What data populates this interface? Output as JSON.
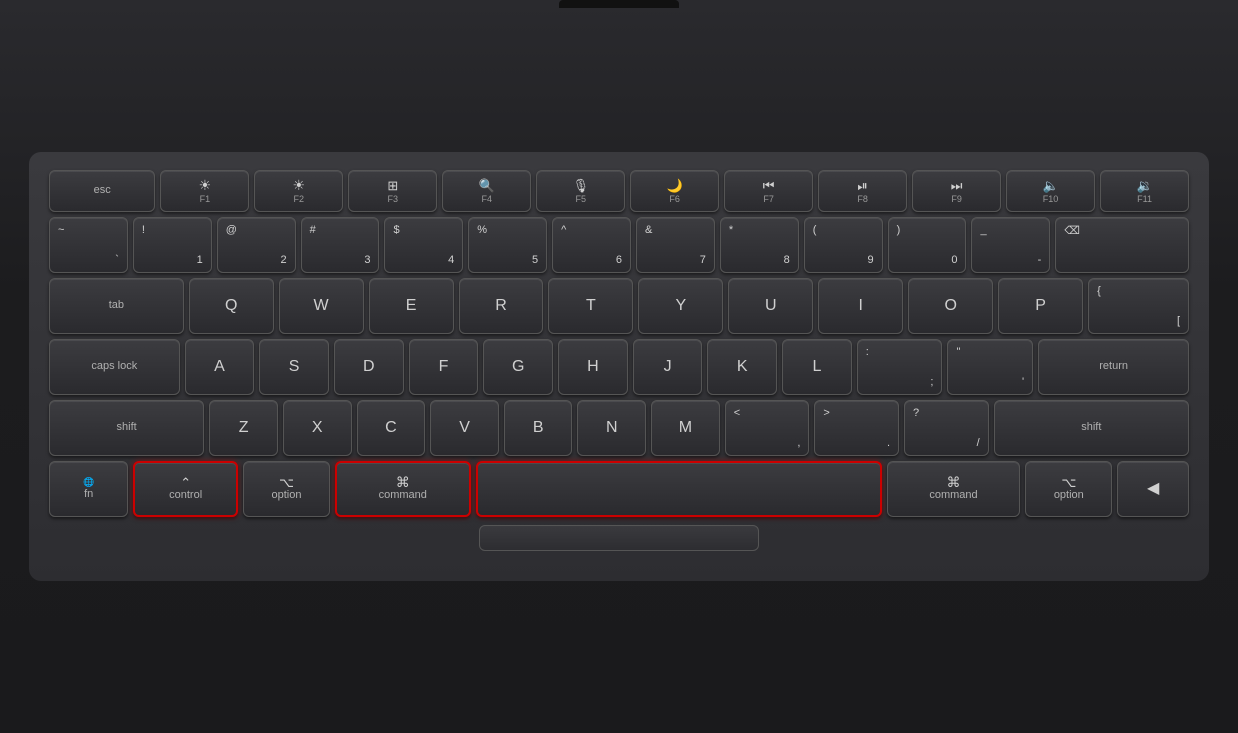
{
  "keyboard": {
    "bg_color": "#2d2d31",
    "rows": {
      "fn_row": [
        {
          "id": "esc",
          "label": "esc",
          "width": "esc"
        },
        {
          "id": "f1",
          "icon": "☀",
          "sub": "F1"
        },
        {
          "id": "f2",
          "icon": "☀",
          "sub": "F2"
        },
        {
          "id": "f3",
          "icon": "⊞",
          "sub": "F3"
        },
        {
          "id": "f4",
          "icon": "⌕",
          "sub": "F4"
        },
        {
          "id": "f5",
          "icon": "🎤",
          "sub": "F5"
        },
        {
          "id": "f6",
          "icon": "🌙",
          "sub": "F6"
        },
        {
          "id": "f7",
          "icon": "⏮",
          "sub": "F7"
        },
        {
          "id": "f8",
          "icon": "⏯",
          "sub": "F8"
        },
        {
          "id": "f9",
          "icon": "⏭",
          "sub": "F9"
        },
        {
          "id": "f10",
          "icon": "🔈",
          "sub": "F10"
        },
        {
          "id": "f11",
          "icon": "🔉",
          "sub": "F11"
        }
      ]
    }
  }
}
